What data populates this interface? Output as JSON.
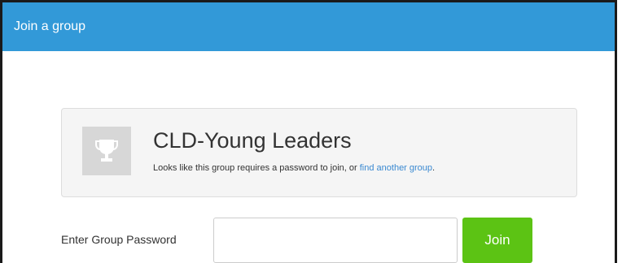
{
  "header": {
    "title": "Join a group"
  },
  "group": {
    "name": "CLD-Young Leaders",
    "message_prefix": "Looks like this group requires a password to join, or ",
    "message_link": "find another group",
    "message_suffix": ".",
    "icon": "trophy-icon"
  },
  "password_form": {
    "label": "Enter Group Password",
    "value": "",
    "join_label": "Join"
  },
  "colors": {
    "header_bg": "#3299d8",
    "join_button": "#5cc314",
    "link": "#3a89d1"
  }
}
